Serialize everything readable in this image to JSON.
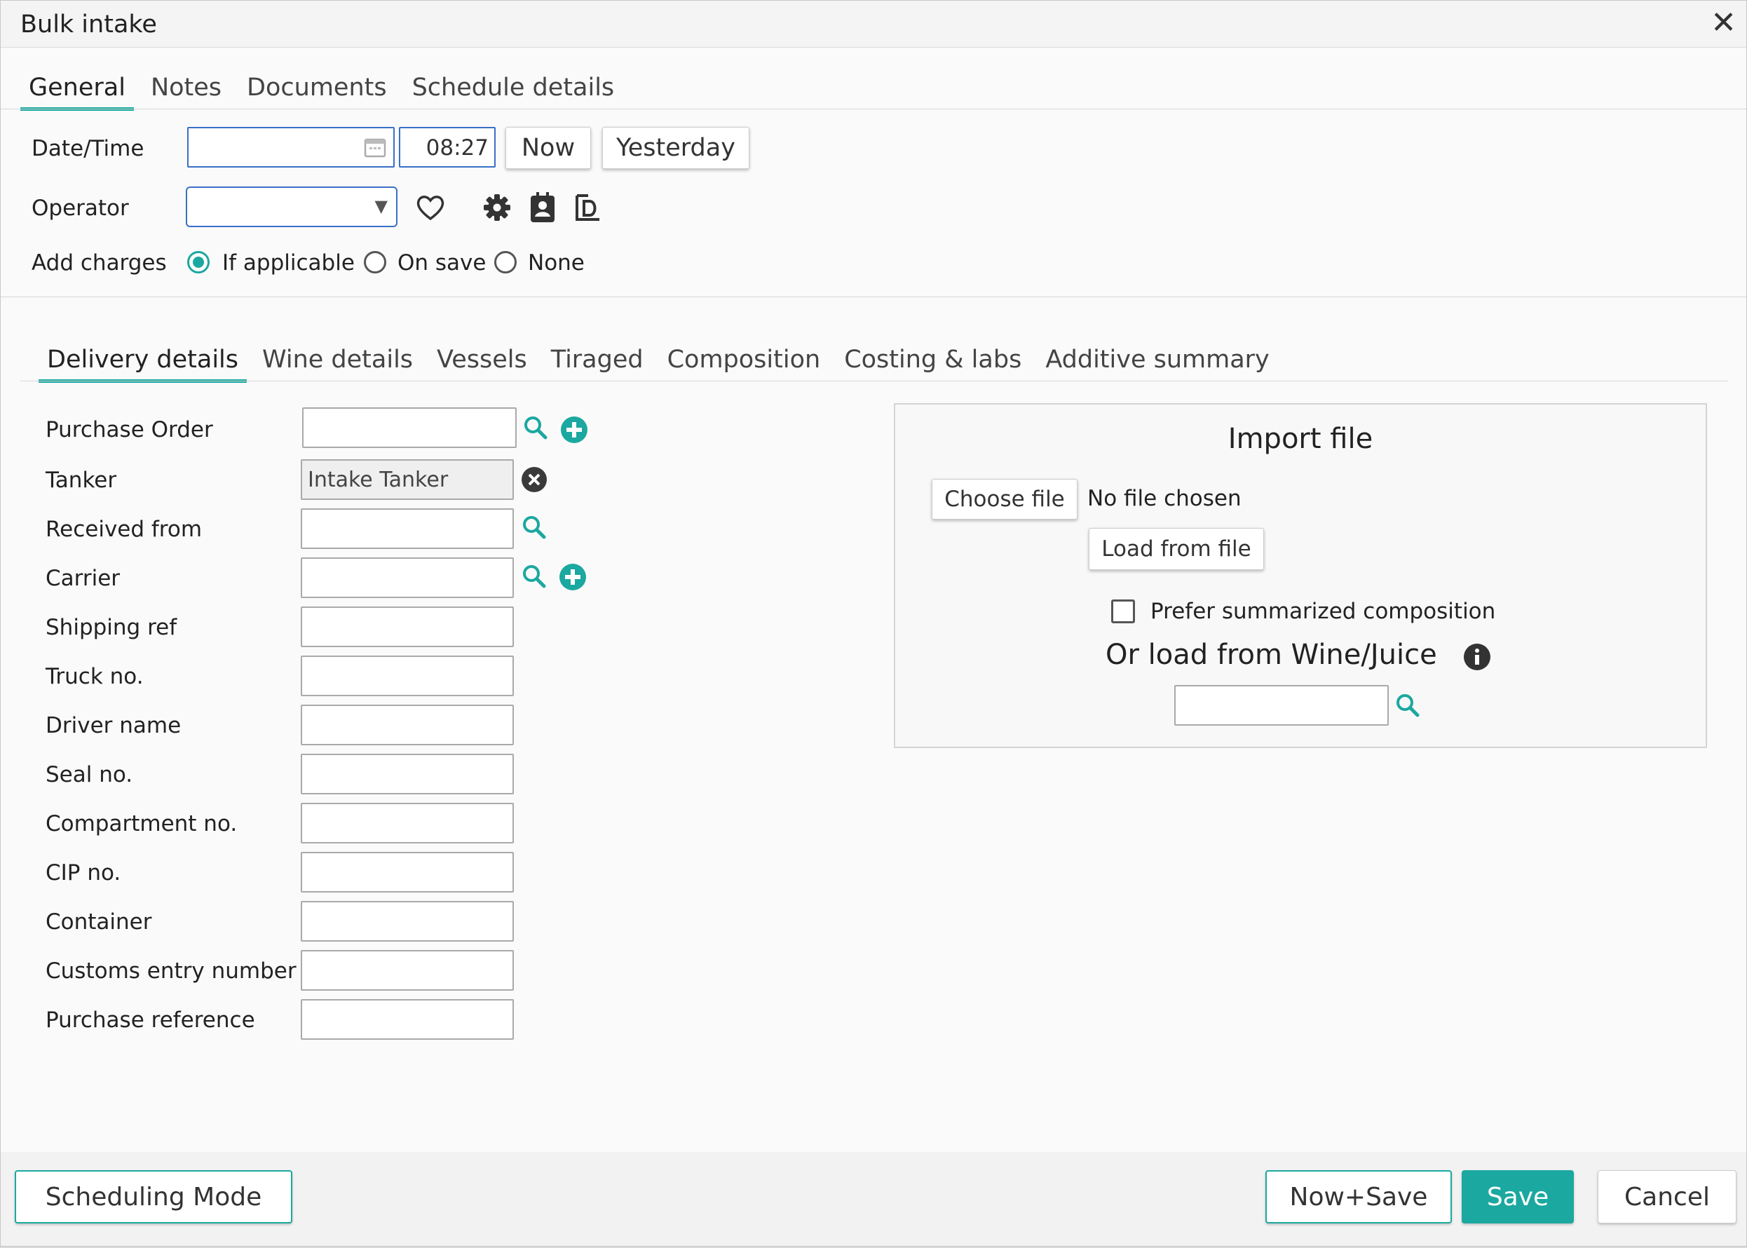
{
  "window": {
    "title": "Bulk intake"
  },
  "top_tabs": [
    "General",
    "Notes",
    "Documents",
    "Schedule details"
  ],
  "general": {
    "datetime_label": "Date/Time",
    "date_value": "",
    "time_value": "08:27",
    "now_button": "Now",
    "yesterday_button": "Yesterday",
    "operator_label": "Operator",
    "operator_value": "",
    "add_charges_label": "Add charges",
    "charge_options": [
      "If applicable",
      "On save",
      "None"
    ],
    "charge_selected": "If applicable"
  },
  "sub_tabs": [
    "Delivery details",
    "Wine details",
    "Vessels",
    "Tiraged",
    "Composition",
    "Costing & labs",
    "Additive summary"
  ],
  "delivery": {
    "purchase_order_label": "Purchase Order",
    "tanker_label": "Tanker",
    "tanker_value": "Intake Tanker",
    "received_from_label": "Received from",
    "carrier_label": "Carrier",
    "shipping_ref_label": "Shipping ref",
    "truck_no_label": "Truck no.",
    "driver_name_label": "Driver name",
    "seal_no_label": "Seal no.",
    "compartment_no_label": "Compartment no.",
    "cip_no_label": "CIP no.",
    "container_label": "Container",
    "customs_entry_label": "Customs entry number",
    "purchase_reference_label": "Purchase reference"
  },
  "import": {
    "title": "Import file",
    "choose_file_button": "Choose file",
    "no_file_text": "No file chosen",
    "load_button": "Load from file",
    "prefer_summarized_label": "Prefer summarized composition",
    "or_load_label": "Or load from Wine/Juice"
  },
  "footer": {
    "scheduling_mode": "Scheduling Mode",
    "now_save": "Now+Save",
    "save": "Save",
    "cancel": "Cancel"
  },
  "colors": {
    "accent": "#1ba8a0",
    "field_focus_border": "#3a6fc8"
  }
}
